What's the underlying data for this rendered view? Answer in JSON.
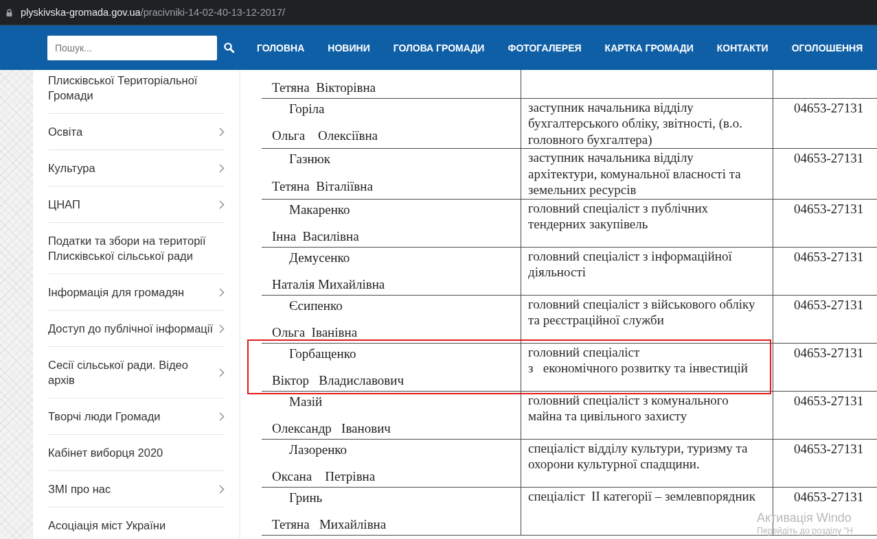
{
  "address_bar": {
    "domain": "plyskivska-gromada.gov.ua",
    "path": "/pracivniki-14-02-40-13-12-2017/"
  },
  "header": {
    "search": {
      "placeholder": "Пошук..."
    },
    "nav": [
      {
        "label": "ГОЛОВНА"
      },
      {
        "label": "НОВИНИ"
      },
      {
        "label": "ГОЛОВА ГРОМАДИ"
      },
      {
        "label": "ФОТОГАЛЕРЕЯ"
      },
      {
        "label": "КАРТКА ГРОМАДИ"
      },
      {
        "label": "КОНТАКТИ"
      },
      {
        "label": "ОГОЛОШЕННЯ"
      }
    ]
  },
  "sidebar": {
    "items": [
      {
        "label": "Плисківської Територіальної Громади",
        "has_submenu": false
      },
      {
        "label": "Освіта",
        "has_submenu": true
      },
      {
        "label": "Культура",
        "has_submenu": true
      },
      {
        "label": "ЦНАП",
        "has_submenu": true
      },
      {
        "label": "Податки та збори на території Плисківської сільської ради",
        "has_submenu": false
      },
      {
        "label": "Інформація для громадян",
        "has_submenu": true
      },
      {
        "label": "Доступ до публічної інформації",
        "has_submenu": true
      },
      {
        "label": "Сесії сільської ради. Відео архів",
        "has_submenu": true
      },
      {
        "label": "Творчі люди Громади",
        "has_submenu": true
      },
      {
        "label": "Кабінет виборця 2020",
        "has_submenu": false
      },
      {
        "label": "ЗМІ про нас",
        "has_submenu": true
      },
      {
        "label": "Асоціація міст України",
        "has_submenu": false
      }
    ]
  },
  "staff_table": {
    "rows": [
      {
        "name": "Тетяна  Вікторівна",
        "highlighted": false
      },
      {
        "surname": "Горіла",
        "name": "Ольга    Олексіївна",
        "position": "заступник начальника відділу бухгалтерського обліку, звітності, (в.о. головного бухгалтера)",
        "phone": "04653-27131",
        "highlighted": false
      },
      {
        "surname": "Газнюк",
        "name": "Тетяна  Віталіївна",
        "position": "заступник начальника відділу архітектури, комунальної власності та земельних ресурсів",
        "phone": "04653-27131",
        "highlighted": false
      },
      {
        "surname": "Макаренко",
        "name": "Інна  Василівна",
        "position": "головний спеціаліст з публічних тендерних закупівель",
        "phone": "04653-27131",
        "highlighted": false
      },
      {
        "surname": "Демусенко",
        "name": "Наталія Михайлівна",
        "position": "головний спеціаліст з інформаційної діяльності",
        "phone": "04653-27131",
        "highlighted": false
      },
      {
        "surname": "Єсипенко",
        "name": "Ольга  Іванівна",
        "position": "головний спеціаліст з військового обліку та реєстраційної служби",
        "phone": "04653-27131",
        "highlighted": false
      },
      {
        "surname": "Горбащенко",
        "name": "Віктор   Владиславович",
        "position": "головний спеціаліст\nз   економічного розвитку та інвестицій",
        "phone": "04653-27131",
        "highlighted": true
      },
      {
        "surname": "Мазій",
        "name": "Олександр   Іванович",
        "position": "головний спеціаліст з комунального майна та цивільного захисту",
        "phone": "04653-27131",
        "highlighted": false
      },
      {
        "surname": "Лазоренко",
        "name": "Оксана    Петрівна",
        "position": "спеціаліст відділу культури, туризму та охорони культурної спадщини.",
        "phone": "04653-27131",
        "highlighted": false
      },
      {
        "surname": "Гринь",
        "name": "Тетяна   Михайлівна",
        "position": "спеціаліст  ІІ категорії – землевпорядник",
        "phone": "04653-27131",
        "highlighted": false
      }
    ]
  },
  "os_notice": {
    "title": "Активація Windo",
    "hint": "Перейдіть до розділу \"Н"
  }
}
